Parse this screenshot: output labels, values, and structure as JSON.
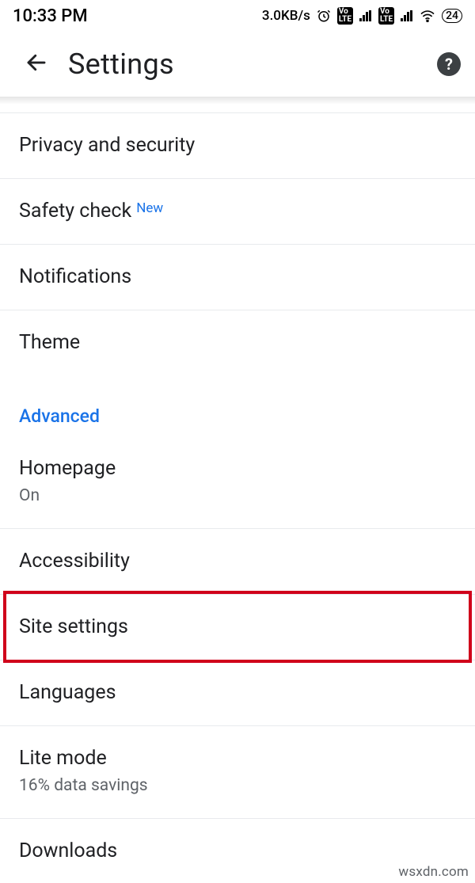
{
  "status": {
    "time": "10:33 PM",
    "net_speed": "3.0KB/s",
    "battery": "24"
  },
  "header": {
    "title": "Settings"
  },
  "section": {
    "advanced_label": "Advanced"
  },
  "items": {
    "privacy": {
      "label": "Privacy and security"
    },
    "safety_check": {
      "label": "Safety check",
      "badge": "New"
    },
    "notifications": {
      "label": "Notifications"
    },
    "theme": {
      "label": "Theme"
    },
    "homepage": {
      "label": "Homepage",
      "sub": "On"
    },
    "accessibility": {
      "label": "Accessibility"
    },
    "site_settings": {
      "label": "Site settings"
    },
    "languages": {
      "label": "Languages"
    },
    "lite_mode": {
      "label": "Lite mode",
      "sub": "16% data savings"
    },
    "downloads": {
      "label": "Downloads"
    }
  },
  "watermark": "wsxdn.com",
  "colors": {
    "accent": "#1a73e8",
    "highlight": "#d0021b",
    "text_secondary": "#5f6368"
  }
}
